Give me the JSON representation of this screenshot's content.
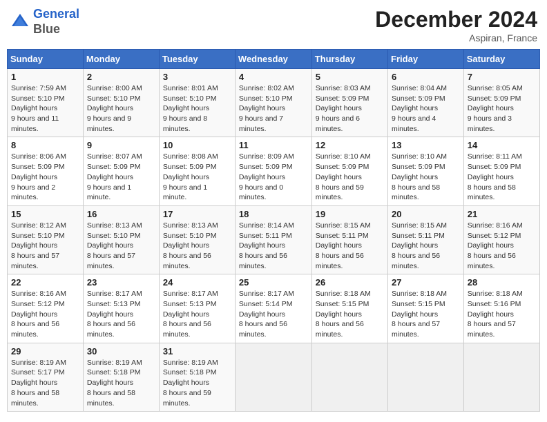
{
  "header": {
    "logo_line1": "General",
    "logo_line2": "Blue",
    "month": "December 2024",
    "location": "Aspiran, France"
  },
  "weekdays": [
    "Sunday",
    "Monday",
    "Tuesday",
    "Wednesday",
    "Thursday",
    "Friday",
    "Saturday"
  ],
  "weeks": [
    [
      {
        "day": "1",
        "sunrise": "7:59 AM",
        "sunset": "5:10 PM",
        "daylight": "9 hours and 11 minutes."
      },
      {
        "day": "2",
        "sunrise": "8:00 AM",
        "sunset": "5:10 PM",
        "daylight": "9 hours and 9 minutes."
      },
      {
        "day": "3",
        "sunrise": "8:01 AM",
        "sunset": "5:10 PM",
        "daylight": "9 hours and 8 minutes."
      },
      {
        "day": "4",
        "sunrise": "8:02 AM",
        "sunset": "5:10 PM",
        "daylight": "9 hours and 7 minutes."
      },
      {
        "day": "5",
        "sunrise": "8:03 AM",
        "sunset": "5:09 PM",
        "daylight": "9 hours and 6 minutes."
      },
      {
        "day": "6",
        "sunrise": "8:04 AM",
        "sunset": "5:09 PM",
        "daylight": "9 hours and 4 minutes."
      },
      {
        "day": "7",
        "sunrise": "8:05 AM",
        "sunset": "5:09 PM",
        "daylight": "9 hours and 3 minutes."
      }
    ],
    [
      {
        "day": "8",
        "sunrise": "8:06 AM",
        "sunset": "5:09 PM",
        "daylight": "9 hours and 2 minutes."
      },
      {
        "day": "9",
        "sunrise": "8:07 AM",
        "sunset": "5:09 PM",
        "daylight": "9 hours and 1 minute."
      },
      {
        "day": "10",
        "sunrise": "8:08 AM",
        "sunset": "5:09 PM",
        "daylight": "9 hours and 1 minute."
      },
      {
        "day": "11",
        "sunrise": "8:09 AM",
        "sunset": "5:09 PM",
        "daylight": "9 hours and 0 minutes."
      },
      {
        "day": "12",
        "sunrise": "8:10 AM",
        "sunset": "5:09 PM",
        "daylight": "8 hours and 59 minutes."
      },
      {
        "day": "13",
        "sunrise": "8:10 AM",
        "sunset": "5:09 PM",
        "daylight": "8 hours and 58 minutes."
      },
      {
        "day": "14",
        "sunrise": "8:11 AM",
        "sunset": "5:09 PM",
        "daylight": "8 hours and 58 minutes."
      }
    ],
    [
      {
        "day": "15",
        "sunrise": "8:12 AM",
        "sunset": "5:10 PM",
        "daylight": "8 hours and 57 minutes."
      },
      {
        "day": "16",
        "sunrise": "8:13 AM",
        "sunset": "5:10 PM",
        "daylight": "8 hours and 57 minutes."
      },
      {
        "day": "17",
        "sunrise": "8:13 AM",
        "sunset": "5:10 PM",
        "daylight": "8 hours and 56 minutes."
      },
      {
        "day": "18",
        "sunrise": "8:14 AM",
        "sunset": "5:11 PM",
        "daylight": "8 hours and 56 minutes."
      },
      {
        "day": "19",
        "sunrise": "8:15 AM",
        "sunset": "5:11 PM",
        "daylight": "8 hours and 56 minutes."
      },
      {
        "day": "20",
        "sunrise": "8:15 AM",
        "sunset": "5:11 PM",
        "daylight": "8 hours and 56 minutes."
      },
      {
        "day": "21",
        "sunrise": "8:16 AM",
        "sunset": "5:12 PM",
        "daylight": "8 hours and 56 minutes."
      }
    ],
    [
      {
        "day": "22",
        "sunrise": "8:16 AM",
        "sunset": "5:12 PM",
        "daylight": "8 hours and 56 minutes."
      },
      {
        "day": "23",
        "sunrise": "8:17 AM",
        "sunset": "5:13 PM",
        "daylight": "8 hours and 56 minutes."
      },
      {
        "day": "24",
        "sunrise": "8:17 AM",
        "sunset": "5:13 PM",
        "daylight": "8 hours and 56 minutes."
      },
      {
        "day": "25",
        "sunrise": "8:17 AM",
        "sunset": "5:14 PM",
        "daylight": "8 hours and 56 minutes."
      },
      {
        "day": "26",
        "sunrise": "8:18 AM",
        "sunset": "5:15 PM",
        "daylight": "8 hours and 56 minutes."
      },
      {
        "day": "27",
        "sunrise": "8:18 AM",
        "sunset": "5:15 PM",
        "daylight": "8 hours and 57 minutes."
      },
      {
        "day": "28",
        "sunrise": "8:18 AM",
        "sunset": "5:16 PM",
        "daylight": "8 hours and 57 minutes."
      }
    ],
    [
      {
        "day": "29",
        "sunrise": "8:19 AM",
        "sunset": "5:17 PM",
        "daylight": "8 hours and 58 minutes."
      },
      {
        "day": "30",
        "sunrise": "8:19 AM",
        "sunset": "5:18 PM",
        "daylight": "8 hours and 58 minutes."
      },
      {
        "day": "31",
        "sunrise": "8:19 AM",
        "sunset": "5:18 PM",
        "daylight": "8 hours and 59 minutes."
      },
      null,
      null,
      null,
      null
    ]
  ]
}
